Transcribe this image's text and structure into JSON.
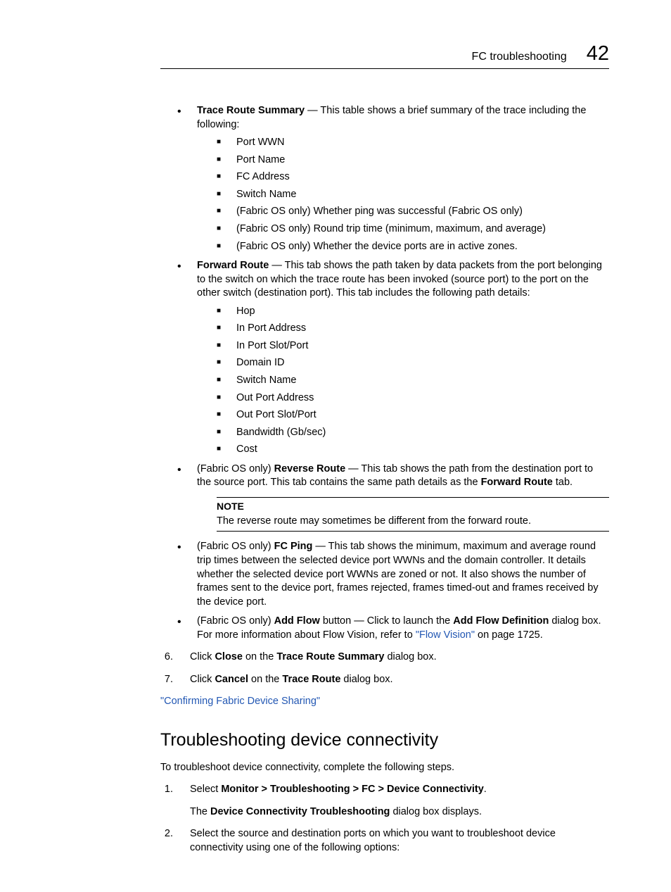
{
  "header": {
    "title": "FC troubleshooting",
    "number": "42"
  },
  "bullets_a": {
    "item1": {
      "label": "Trace Route Summary",
      "text": " — This table shows a brief summary of the trace including the following:",
      "subs": [
        "Port WWN",
        "Port Name",
        "FC Address",
        "Switch Name",
        "(Fabric OS only) Whether ping was successful (Fabric OS only)",
        "(Fabric OS only) Round trip time (minimum, maximum, and average)",
        "(Fabric OS only) Whether the device ports are in active zones."
      ]
    },
    "item2": {
      "label": "Forward Route",
      "text": " — This tab shows the path taken by data packets from the port belonging to the switch on which the trace route has been invoked (source port) to the port on the other switch (destination port). This tab includes the following path details:",
      "subs": [
        "Hop",
        "In Port Address",
        "In Port Slot/Port",
        "Domain ID",
        "Switch Name",
        "Out Port Address",
        "Out Port Slot/Port",
        "Bandwidth (Gb/sec)",
        "Cost"
      ]
    },
    "item3": {
      "prefix": "(Fabric OS only) ",
      "label": "Reverse Route",
      "t1": " — This tab shows the path from the destination port to the source port. This tab contains the same path details as the ",
      "label2": "Forward Route",
      "t2": " tab."
    },
    "note": {
      "label": "NOTE",
      "text": "The reverse route may sometimes be different from the forward route."
    },
    "item4": {
      "prefix": "(Fabric OS only) ",
      "label": "FC Ping",
      "text": " — This tab shows the minimum, maximum and average round trip times between the selected device port WWNs and the domain controller. It details whether the selected device port WWNs are zoned or not. It also shows the number of frames sent to the device port, frames rejected, frames timed-out and frames received by the device port."
    },
    "item5": {
      "prefix": "(Fabric OS only) ",
      "label": "Add Flow",
      "t1": " button — Click to launch the ",
      "label2": "Add Flow Definition",
      "t2": " dialog box. For more information about Flow Vision, refer to ",
      "link": "\"Flow Vision\"",
      "t3": " on page 1725."
    }
  },
  "steps": {
    "s6": {
      "a": "Click ",
      "b": "Close",
      "c": " on the ",
      "d": "Trace Route Summary",
      "e": " dialog box."
    },
    "s7": {
      "a": "Click ",
      "b": "Cancel",
      "c": " on the ",
      "d": "Trace Route",
      "e": " dialog box."
    }
  },
  "link_confirm": "\"Confirming Fabric Device Sharing\"",
  "section": {
    "title": "Troubleshooting device connectivity",
    "intro": "To troubleshoot device connectivity, complete the following steps.",
    "s1": {
      "a": "Select ",
      "b": "Monitor > Troubleshooting > FC > Device Connectivity",
      "c": ".",
      "sub_a": "The ",
      "sub_b": "Device Connectivity Troubleshooting",
      "sub_c": " dialog box displays."
    },
    "s2": "Select the source and destination ports on which you want to troubleshoot device connectivity using one of the following options:"
  }
}
